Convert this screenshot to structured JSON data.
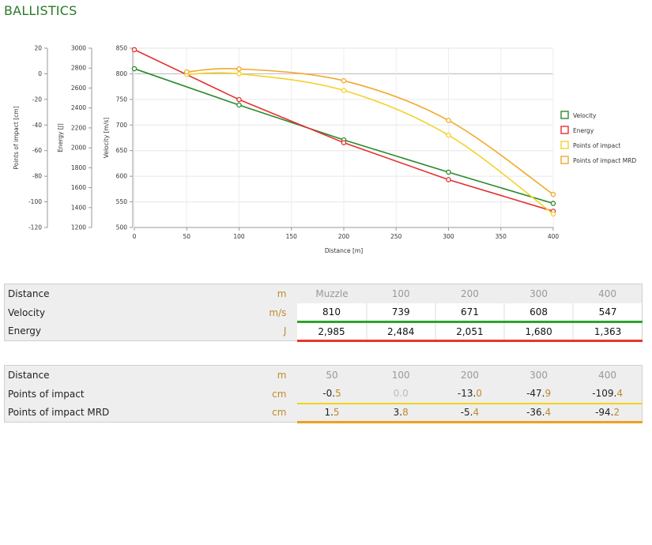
{
  "page": {
    "title": "BALLISTICS"
  },
  "chart_data": {
    "type": "line",
    "xlabel": "Distance [m]",
    "x_ticks": [
      "0",
      "50",
      "100",
      "150",
      "200",
      "250",
      "300",
      "350",
      "400"
    ],
    "xlim": [
      0,
      400
    ],
    "axes": [
      {
        "label": "Points of impact [cm]",
        "ylim": [
          -120,
          20
        ],
        "ticks": [
          "20",
          "0",
          "-20",
          "-40",
          "-60",
          "-80",
          "-100",
          "-120"
        ]
      },
      {
        "label": "Energy [J]",
        "ylim": [
          1200,
          3000
        ],
        "ticks": [
          "3000",
          "2800",
          "2600",
          "2400",
          "2200",
          "2000",
          "1800",
          "1600",
          "1400",
          "1200"
        ]
      },
      {
        "label": "Velocity [m/s]",
        "ylim": [
          500,
          850
        ],
        "ticks": [
          "850",
          "800",
          "750",
          "700",
          "650",
          "600",
          "550",
          "500"
        ]
      }
    ],
    "series": [
      {
        "name": "Velocity",
        "color": "#2a8a2a",
        "axis": 2,
        "x": [
          0,
          100,
          200,
          300,
          400
        ],
        "values": [
          810,
          739,
          671,
          608,
          547
        ]
      },
      {
        "name": "Energy",
        "color": "#e53030",
        "axis": 1,
        "x": [
          0,
          100,
          200,
          300,
          400
        ],
        "values": [
          2985,
          2484,
          2051,
          1680,
          1363
        ]
      },
      {
        "name": "Points of impact",
        "color": "#f3d22a",
        "axis": 0,
        "x": [
          50,
          100,
          200,
          300,
          400
        ],
        "values": [
          -0.5,
          0.0,
          -13.0,
          -47.9,
          -109.4
        ]
      },
      {
        "name": "Points of impact MRD",
        "color": "#f2a92a",
        "axis": 0,
        "x": [
          50,
          100,
          200,
          300,
          400
        ],
        "values": [
          1.5,
          3.8,
          -5.4,
          -36.4,
          -94.2
        ]
      }
    ],
    "legend": "right",
    "grid": true
  },
  "table1": {
    "rows": [
      {
        "label": "Distance",
        "unit": "m",
        "cells": [
          "Muzzle",
          "100",
          "200",
          "300",
          "400"
        ]
      },
      {
        "label": "Velocity",
        "unit": "m/s",
        "cells": [
          "810",
          "739",
          "671",
          "608",
          "547"
        ]
      },
      {
        "label": "Energy",
        "unit": "J",
        "cells": [
          "2,985",
          "2,484",
          "2,051",
          "1,680",
          "1,363"
        ]
      }
    ]
  },
  "table2": {
    "rows": [
      {
        "label": "Distance",
        "unit": "m",
        "cells": [
          "50",
          "100",
          "200",
          "300",
          "400"
        ]
      },
      {
        "label": "Points of impact",
        "unit": "cm",
        "cells": [
          "-0.5",
          "0.0",
          "-13.0",
          "-47.9",
          "-109.4"
        ]
      },
      {
        "label": "Points of impact MRD",
        "unit": "cm",
        "cells": [
          "1.5",
          "3.8",
          "-5.4",
          "-36.4",
          "-94.2"
        ]
      }
    ]
  }
}
